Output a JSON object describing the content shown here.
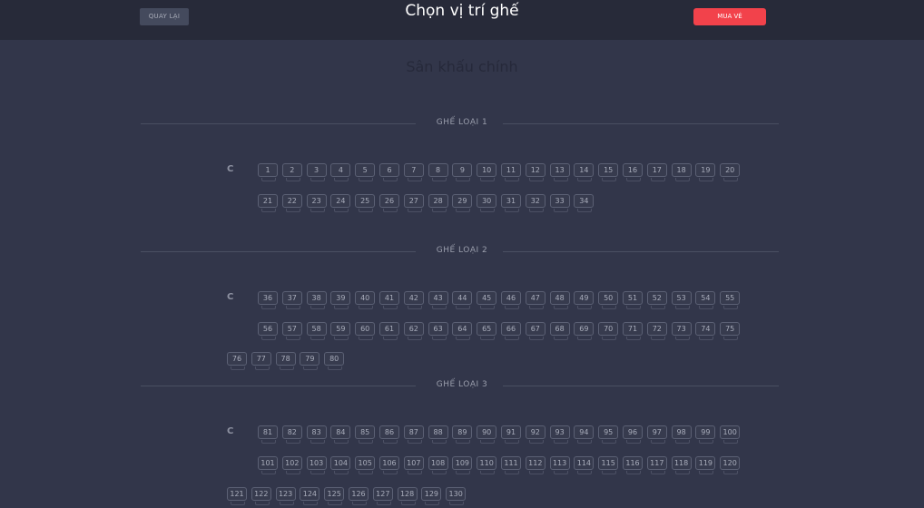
{
  "header": {
    "back_label": "QUAY LẠI",
    "title": "Chọn vị trí ghế",
    "buy_label": "MUA VÉ"
  },
  "stage_label": "Sân khấu chính",
  "sections": [
    {
      "title": "GHẾ LOẠI 1",
      "row_label": "C",
      "seats": [
        "1",
        "2",
        "3",
        "4",
        "5",
        "6",
        "7",
        "8",
        "9",
        "10",
        "11",
        "12",
        "13",
        "14",
        "15",
        "16",
        "17",
        "18",
        "19",
        "20",
        "21",
        "22",
        "23",
        "24",
        "25",
        "26",
        "27",
        "28",
        "29",
        "30",
        "31",
        "32",
        "33",
        "34"
      ]
    },
    {
      "title": "GHẾ LOẠI 2",
      "row_label": "C",
      "seats": [
        "36",
        "37",
        "38",
        "39",
        "40",
        "41",
        "42",
        "43",
        "44",
        "45",
        "46",
        "47",
        "48",
        "49",
        "50",
        "51",
        "52",
        "53",
        "54",
        "55",
        "56",
        "57",
        "58",
        "59",
        "60",
        "61",
        "62",
        "63",
        "64",
        "65",
        "66",
        "67",
        "68",
        "69",
        "70",
        "71",
        "72",
        "73",
        "74",
        "75",
        "76",
        "77",
        "78",
        "79",
        "80"
      ]
    },
    {
      "title": "GHẾ LOẠI 3",
      "row_label": "C",
      "seats": [
        "81",
        "82",
        "83",
        "84",
        "85",
        "86",
        "87",
        "88",
        "89",
        "90",
        "91",
        "92",
        "93",
        "94",
        "95",
        "96",
        "97",
        "98",
        "99",
        "100",
        "101",
        "102",
        "103",
        "104",
        "105",
        "106",
        "107",
        "108",
        "109",
        "110",
        "111",
        "112",
        "113",
        "114",
        "115",
        "116",
        "117",
        "118",
        "119",
        "120",
        "121",
        "122",
        "123",
        "124",
        "125",
        "126",
        "127",
        "128",
        "129",
        "130"
      ]
    }
  ]
}
